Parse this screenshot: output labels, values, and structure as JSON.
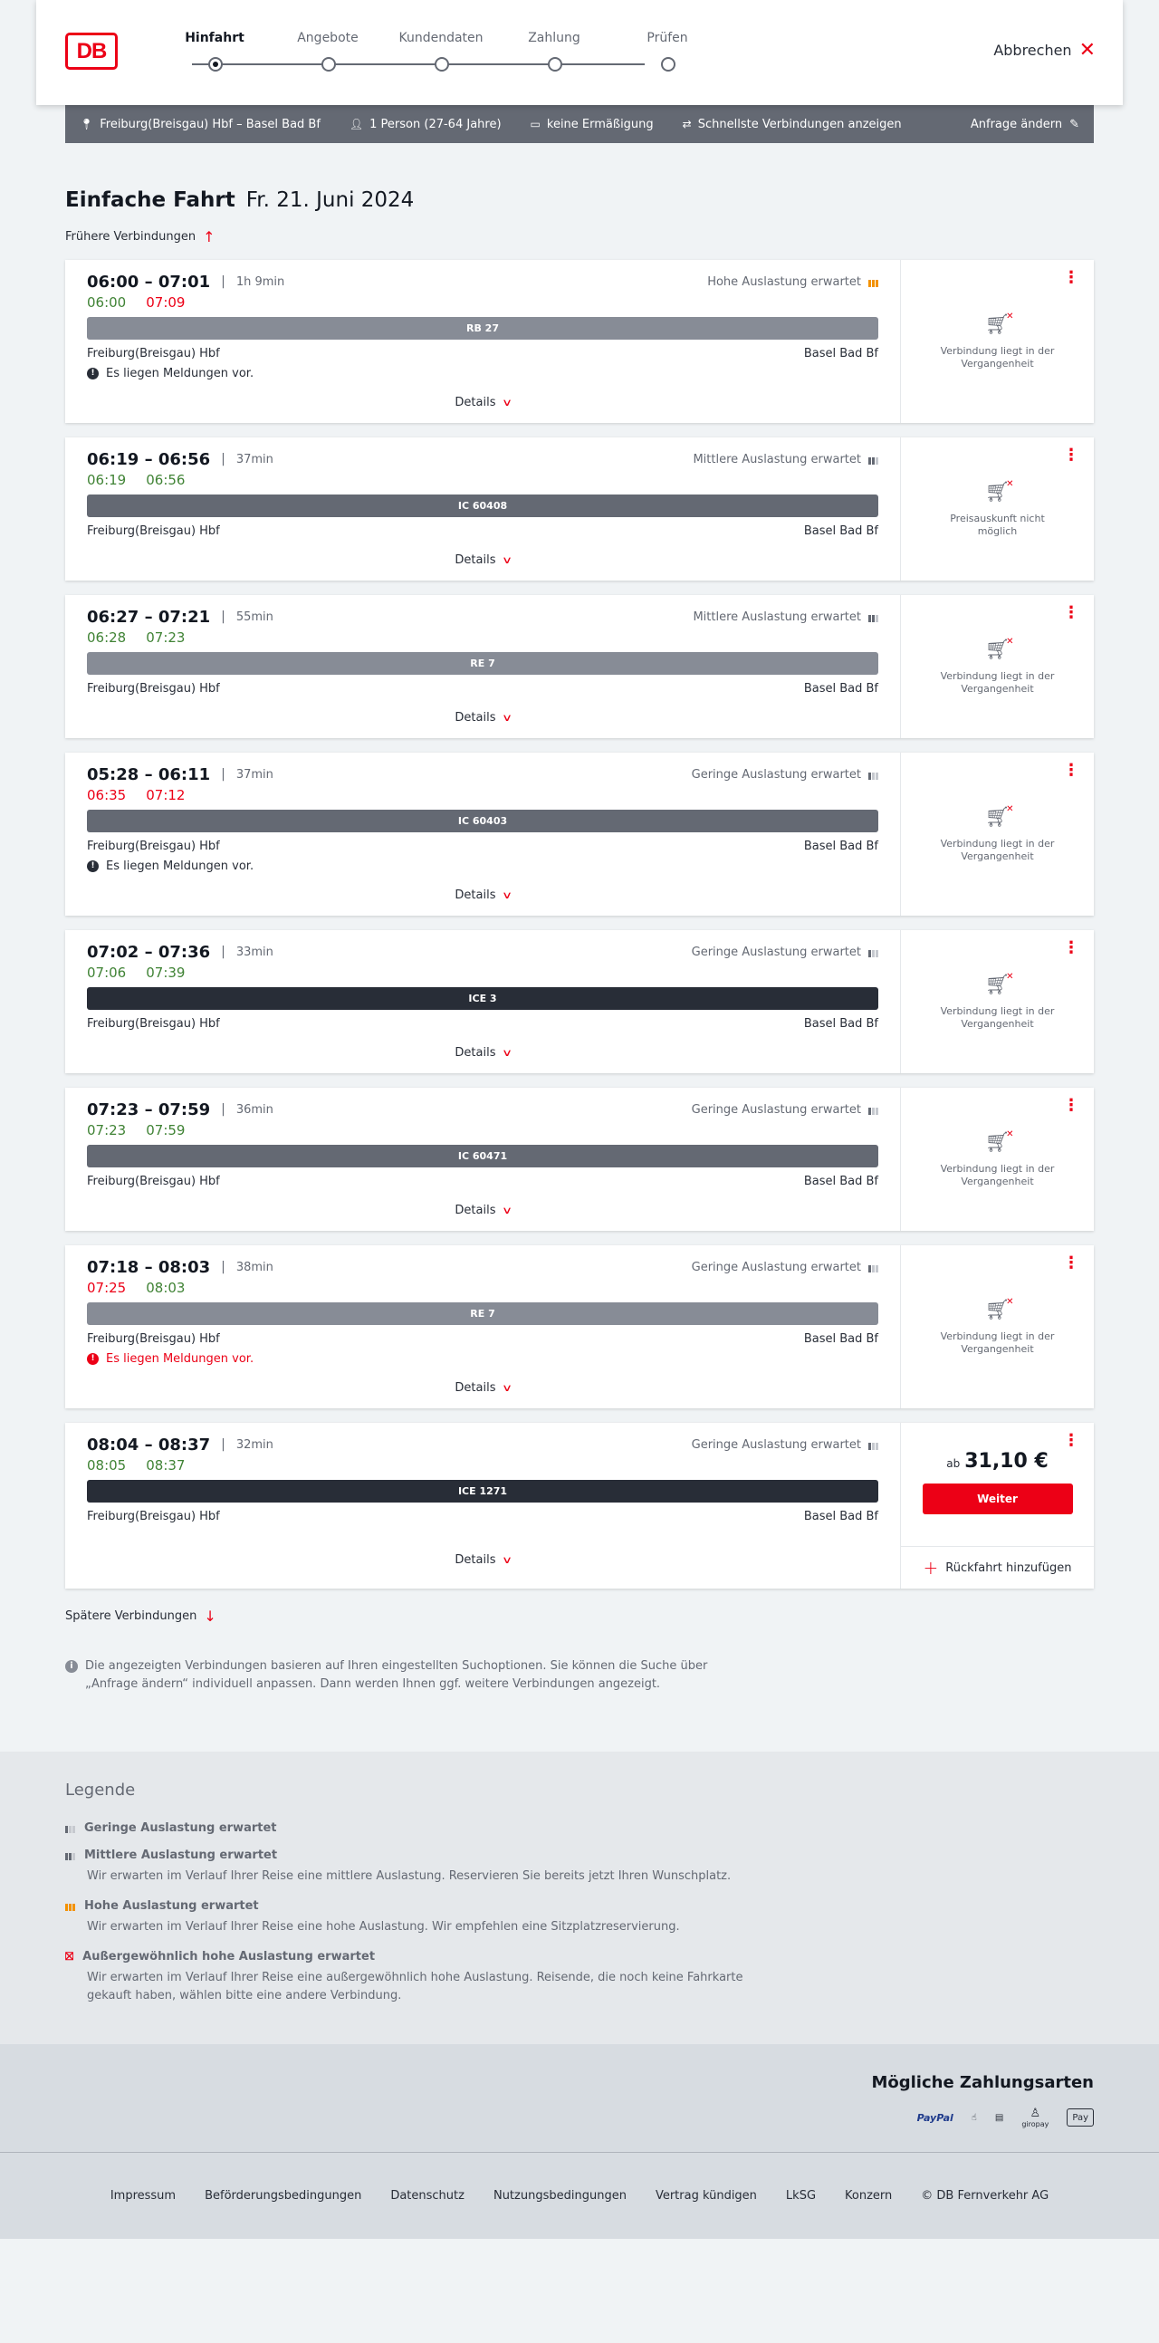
{
  "header": {
    "logo": "DB",
    "steps": [
      "Hinfahrt",
      "Angebote",
      "Kundendaten",
      "Zahlung",
      "Prüfen"
    ],
    "cancel_label": "Abbrechen"
  },
  "filter": {
    "route": "Freiburg(Breisgau) Hbf – Basel Bad Bf",
    "travellers": "1 Person (27-64 Jahre)",
    "discount": "keine Ermäßigung",
    "fastest": "Schnellste Verbindungen anzeigen",
    "change": "Anfrage ändern"
  },
  "main": {
    "title": "Einfache Fahrt",
    "date": "Fr. 21. Juni 2024",
    "earlier": "Frühere Verbindungen",
    "later": "Spätere Verbindungen",
    "details_label": "Details",
    "info_note": "Die angezeigten Verbindungen basieren auf Ihren eingestellten Suchoptionen. Sie können die Suche über „Anfrage ändern“ individuell anpassen. Dann werden Ihnen ggf. weitere Verbindungen angezeigt."
  },
  "connections": [
    {
      "time": "06:00 – 07:01",
      "duration": "1h 9min",
      "load": "Hohe Auslastung erwartet",
      "load_level": 3,
      "rt_dep": "06:00",
      "rt_dep_late": false,
      "rt_arr": "07:09",
      "rt_arr_late": true,
      "train": "RB 27",
      "train_type": "reg",
      "from": "Freiburg(Breisgau) Hbf",
      "to": "Basel Bad Bf",
      "message": "Es liegen Meldungen vor.",
      "message_warn": false,
      "status": "Verbindung liegt in der Vergangenheit"
    },
    {
      "time": "06:19 – 06:56",
      "duration": "37min",
      "load": "Mittlere Auslastung erwartet",
      "load_level": 2,
      "rt_dep": "06:19",
      "rt_dep_late": false,
      "rt_arr": "06:56",
      "rt_arr_late": false,
      "train": "IC 60408",
      "train_type": "ic",
      "from": "Freiburg(Breisgau) Hbf",
      "to": "Basel Bad Bf",
      "message": "",
      "message_warn": false,
      "status": "Preisauskunft nicht möglich"
    },
    {
      "time": "06:27 – 07:21",
      "duration": "55min",
      "load": "Mittlere Auslastung erwartet",
      "load_level": 2,
      "rt_dep": "06:28",
      "rt_dep_late": false,
      "rt_arr": "07:23",
      "rt_arr_late": false,
      "train": "RE 7",
      "train_type": "reg",
      "from": "Freiburg(Breisgau) Hbf",
      "to": "Basel Bad Bf",
      "message": "",
      "message_warn": false,
      "status": "Verbindung liegt in der Vergangenheit"
    },
    {
      "time": "05:28 – 06:11",
      "duration": "37min",
      "load": "Geringe Auslastung erwartet",
      "load_level": 1,
      "rt_dep": "06:35",
      "rt_dep_late": true,
      "rt_arr": "07:12",
      "rt_arr_late": true,
      "train": "IC 60403",
      "train_type": "ic",
      "from": "Freiburg(Breisgau) Hbf",
      "to": "Basel Bad Bf",
      "message": "Es liegen Meldungen vor.",
      "message_warn": false,
      "status": "Verbindung liegt in der Vergangenheit"
    },
    {
      "time": "07:02 – 07:36",
      "duration": "33min",
      "load": "Geringe Auslastung erwartet",
      "load_level": 1,
      "rt_dep": "07:06",
      "rt_dep_late": false,
      "rt_arr": "07:39",
      "rt_arr_late": false,
      "train": "ICE 3",
      "train_type": "ice",
      "from": "Freiburg(Breisgau) Hbf",
      "to": "Basel Bad Bf",
      "message": "",
      "message_warn": false,
      "status": "Verbindung liegt in der Vergangenheit"
    },
    {
      "time": "07:23 – 07:59",
      "duration": "36min",
      "load": "Geringe Auslastung erwartet",
      "load_level": 1,
      "rt_dep": "07:23",
      "rt_dep_late": false,
      "rt_arr": "07:59",
      "rt_arr_late": false,
      "train": "IC 60471",
      "train_type": "ic",
      "from": "Freiburg(Breisgau) Hbf",
      "to": "Basel Bad Bf",
      "message": "",
      "message_warn": false,
      "status": "Verbindung liegt in der Vergangenheit"
    },
    {
      "time": "07:18 – 08:03",
      "duration": "38min",
      "load": "Geringe Auslastung erwartet",
      "load_level": 1,
      "rt_dep": "07:25",
      "rt_dep_late": true,
      "rt_arr": "08:03",
      "rt_arr_late": false,
      "train": "RE 7",
      "train_type": "reg",
      "from": "Freiburg(Breisgau) Hbf",
      "to": "Basel Bad Bf",
      "message": "Es liegen Meldungen vor.",
      "message_warn": true,
      "status": "Verbindung liegt in der Vergangenheit"
    }
  ],
  "offer": {
    "time": "08:04 – 08:37",
    "duration": "32min",
    "load": "Geringe Auslastung erwartet",
    "rt_dep": "08:05",
    "rt_arr": "08:37",
    "train": "ICE 1271",
    "from": "Freiburg(Breisgau) Hbf",
    "to": "Basel Bad Bf",
    "price_prefix": "ab",
    "price": "31,10 €",
    "button": "Weiter",
    "return_label": "Rückfahrt hinzufügen"
  },
  "legend": {
    "title": "Legende",
    "items": [
      {
        "head": "Geringe Auslastung erwartet",
        "desc": ""
      },
      {
        "head": "Mittlere Auslastung erwartet",
        "desc": "Wir erwarten im Verlauf Ihrer Reise eine mittlere Auslastung. Reservieren Sie bereits jetzt Ihren Wunschplatz."
      },
      {
        "head": "Hohe Auslastung erwartet",
        "desc": "Wir erwarten im Verlauf Ihrer Reise eine hohe Auslastung. Wir empfehlen eine Sitzplatzreservierung."
      },
      {
        "head": "Außergewöhnlich hohe Auslastung erwartet",
        "desc": "Wir erwarten im Verlauf Ihrer Reise eine außergewöhnlich hohe Auslastung. Reisende, die noch keine Fahrkarte gekauft haben, wählen bitte eine andere Verbindung."
      }
    ]
  },
  "payments": {
    "title": "Mögliche Zahlungsarten",
    "methods": [
      "PayPal",
      "giropay",
      "Pay"
    ]
  },
  "footer": {
    "links": [
      "Impressum",
      "Beförderungsbedingungen",
      "Datenschutz",
      "Nutzungsbedingungen",
      "Vertrag kündigen",
      "LkSG",
      "Konzern",
      "© DB Fernverkehr AG"
    ]
  },
  "colors": {
    "accent": "#ec0016",
    "ontime": "#408335",
    "bar": "#646973"
  }
}
